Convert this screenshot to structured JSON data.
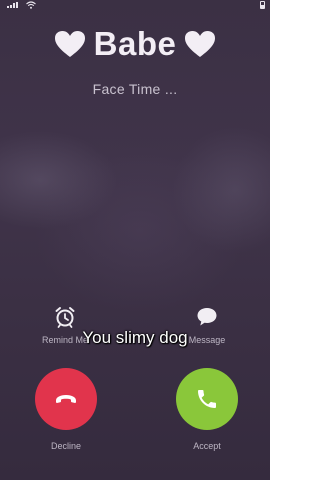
{
  "colors": {
    "background": "#3b3044",
    "decline": "#e1344c",
    "accept": "#8ac73a",
    "text": "#f3eef5"
  },
  "status_bar": {
    "icons": [
      "signal-icon",
      "wifi-icon",
      "battery-icon"
    ]
  },
  "call": {
    "caller_name": "Babe",
    "name_decoration_icon": "heart-icon",
    "status": "Face Time ..."
  },
  "actions": {
    "remind_label": "Remind Me",
    "remind_icon": "alarm-clock-icon",
    "message_label": "Message",
    "message_icon": "speech-bubble-icon"
  },
  "caption": "You slimy dog",
  "buttons": {
    "decline_label": "Decline",
    "decline_icon": "phone-hangup-icon",
    "accept_label": "Accept",
    "accept_icon": "phone-icon"
  }
}
